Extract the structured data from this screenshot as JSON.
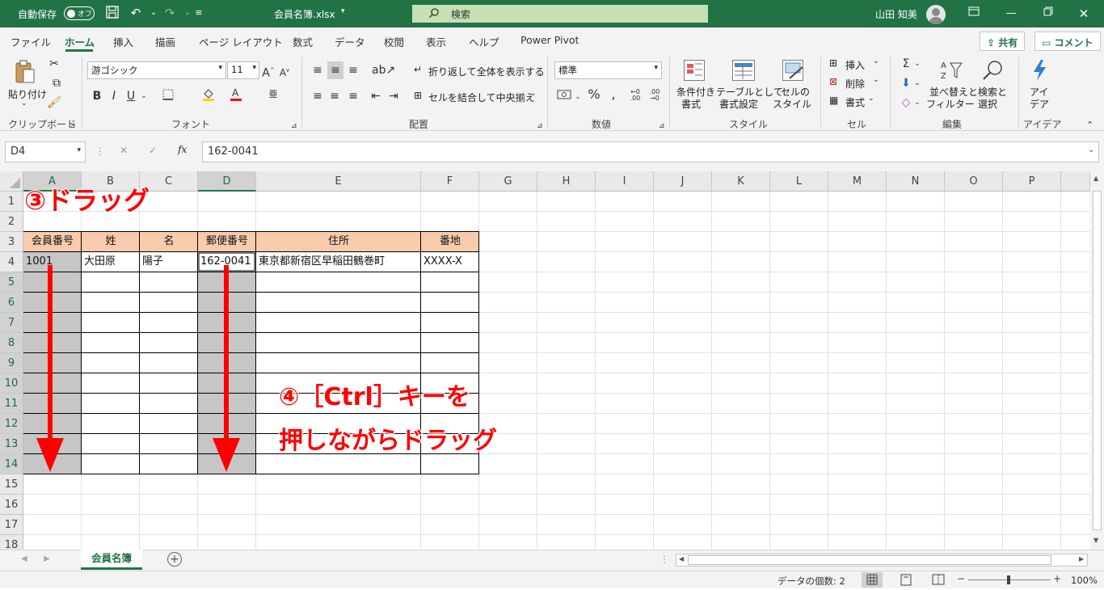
{
  "titlebar": {
    "autosave_label": "自動保存",
    "autosave_state": "オフ",
    "filename": "会員名簿.xlsx",
    "search_placeholder": "検索",
    "user_name": "山田 知美"
  },
  "tabs": [
    "ファイル",
    "ホーム",
    "挿入",
    "描画",
    "ページ レイアウト",
    "数式",
    "データ",
    "校閲",
    "表示",
    "ヘルプ",
    "Power Pivot"
  ],
  "share_label": "共有",
  "comment_label": "コメント",
  "ribbon": {
    "clipboard": {
      "paste": "貼り付け",
      "group": "クリップボード"
    },
    "font": {
      "name": "游ゴシック",
      "size": "11",
      "group": "フォント"
    },
    "alignment": {
      "wrap": "折り返して全体を表示する",
      "merge": "セルを結合して中央揃え",
      "group": "配置"
    },
    "number": {
      "format": "標準",
      "group": "数値"
    },
    "styles": {
      "conditional": [
        "条件付き",
        "書式"
      ],
      "table": [
        "テーブルとして",
        "書式設定"
      ],
      "cell": [
        "セルの",
        "スタイル"
      ],
      "group": "スタイル"
    },
    "cells": {
      "insert": "挿入",
      "delete": "削除",
      "format": "書式",
      "group": "セル"
    },
    "editing": {
      "sort": [
        "並べ替えと",
        "フィルター"
      ],
      "find": [
        "検索と",
        "選択"
      ],
      "group": "編集"
    },
    "ideas": {
      "label": [
        "アイ",
        "デア"
      ],
      "group": "アイデア"
    }
  },
  "formula_bar": {
    "namebox": "D4",
    "fx": "fx",
    "value": "162-0041"
  },
  "columns": [
    "A",
    "B",
    "C",
    "D",
    "E",
    "F",
    "G",
    "H",
    "I",
    "J",
    "K",
    "L",
    "M",
    "N",
    "O",
    "P"
  ],
  "rows": [
    "1",
    "2",
    "3",
    "4",
    "5",
    "6",
    "7",
    "8",
    "9",
    "10",
    "11",
    "12",
    "13",
    "14",
    "15",
    "16",
    "17",
    "18"
  ],
  "table": {
    "headers": [
      "会員番号",
      "姓",
      "名",
      "郵便番号",
      "住所",
      "番地"
    ],
    "row4": [
      "1001",
      "大田原",
      "陽子",
      "162-0041",
      "東京都新宿区早稲田鶴巻町",
      "XXXX-X"
    ]
  },
  "annotations": {
    "step3": "③ドラッグ",
    "step4_line1": "④［Ctrl］キーを",
    "step4_line2": "押しながらドラッグ"
  },
  "sheet_tab": "会員名簿",
  "status": {
    "count": "データの個数: 2",
    "zoom": "100%"
  },
  "colors": {
    "accent": "#217346",
    "header_fill": "#f8cbad",
    "arrow": "#ff0000"
  }
}
